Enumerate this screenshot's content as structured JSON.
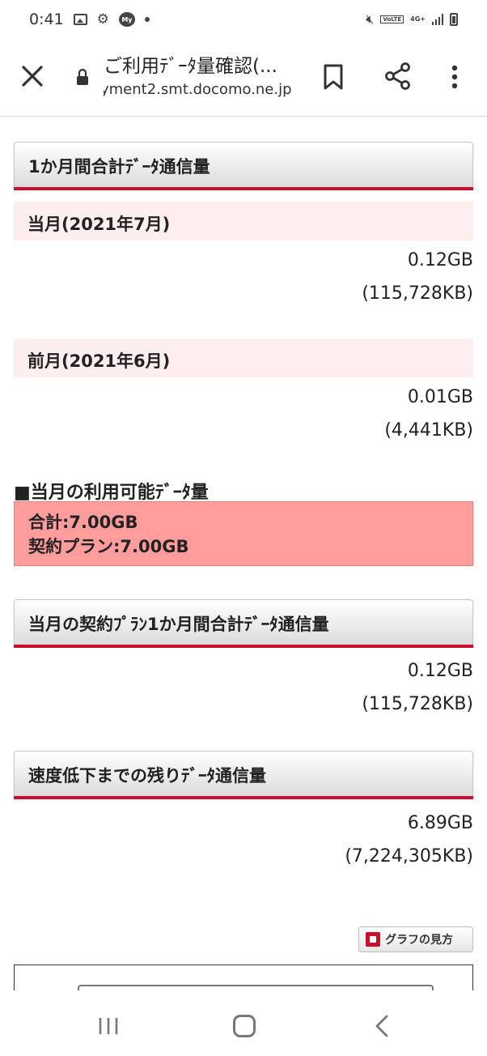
{
  "status_bar": {
    "time": "0:41",
    "my_badge": "My",
    "network": "4G+",
    "volte": "VoLTE"
  },
  "browser": {
    "page_title": "ご利用ﾃﾞｰﾀ量確認(...",
    "url": "yment2.smt.docomo.ne.jp"
  },
  "sections": {
    "monthly_total": {
      "title": "1か月間合計ﾃﾞｰﾀ通信量",
      "current_month": {
        "label": "当月(2021年7月)",
        "value_gb": "0.12GB",
        "value_kb": "(115,728KB)"
      },
      "previous_month": {
        "label": "前月(2021年6月)",
        "value_gb": "0.01GB",
        "value_kb": "(4,441KB)"
      }
    },
    "available": {
      "title": "■当月の利用可能ﾃﾞｰﾀ量",
      "total": "合計:7.00GB",
      "plan": "契約プラン:7.00GB"
    },
    "plan_total": {
      "title": "当月の契約ﾌﾟﾗﾝ1か月間合計ﾃﾞｰﾀ通信量",
      "value_gb": "0.12GB",
      "value_kb": "(115,728KB)"
    },
    "remaining": {
      "title": "速度低下までの残りﾃﾞｰﾀ通信量",
      "value_gb": "6.89GB",
      "value_kb": "(7,224,305KB)"
    }
  },
  "graph_help": {
    "label": "グラフの見方"
  }
}
